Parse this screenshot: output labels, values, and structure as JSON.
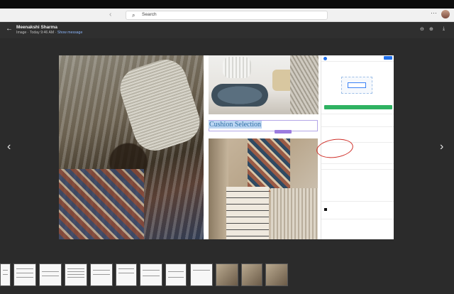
{
  "search": {
    "placeholder": "Search"
  },
  "header": {
    "sender": "Meenakshi Sharma",
    "meta_prefix": "Image · Today 9:46 AM · ",
    "show_message": "Show message"
  },
  "document": {
    "caption": "Cushion Selection"
  },
  "icons": {
    "back": "arrow-left-icon",
    "search": "search-icon",
    "zoom_out": "zoom-out-icon",
    "zoom_in": "zoom-in-icon",
    "more": "more-vertical-icon",
    "download": "download-icon",
    "prev": "chevron-left-icon",
    "next": "chevron-right-icon",
    "nav_prev": "chevron-left-icon",
    "nav_next": "chevron-right-icon"
  },
  "colors": {
    "accent_link": "#8ab4f8",
    "caption_text": "#2f6fa6",
    "caption_highlight": "#bcd6f2",
    "annotation_red": "#d0302a",
    "panel_green": "#2eb262",
    "panel_blue": "#1f6feb"
  }
}
